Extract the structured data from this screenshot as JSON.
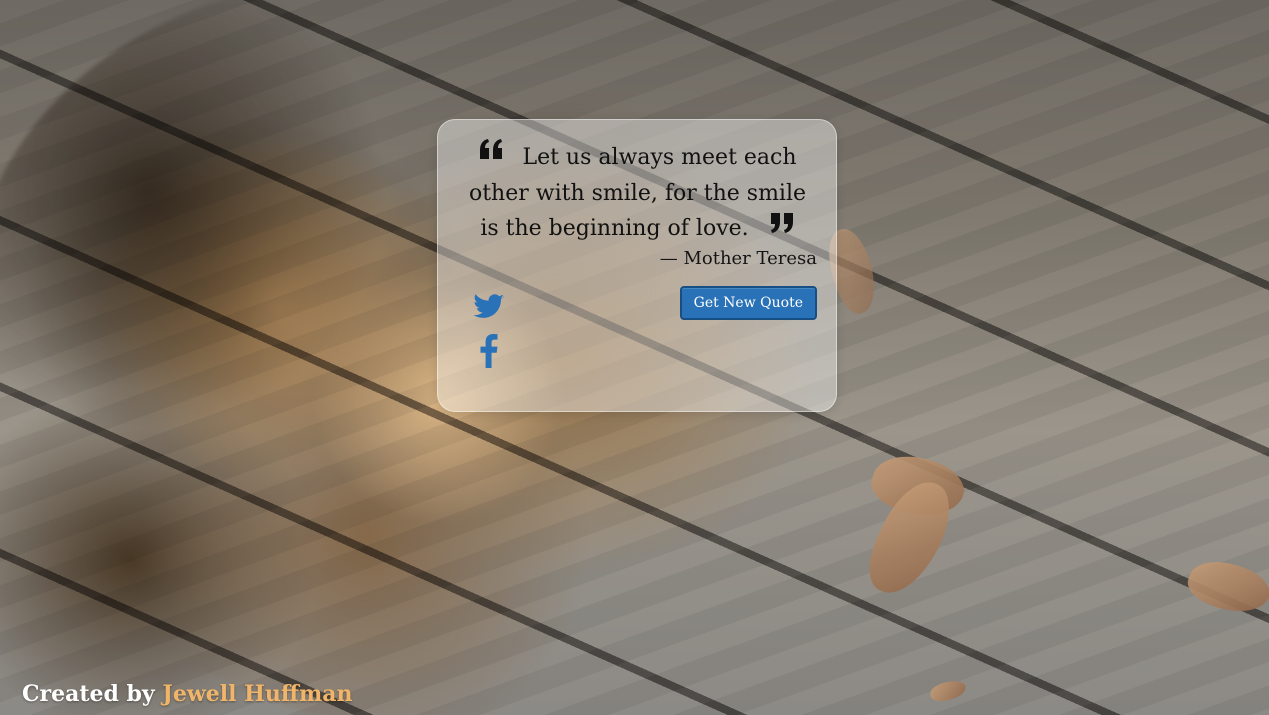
{
  "quote": {
    "text": "Let us always meet each other with smile, for the smile is the beginning of love.",
    "author": "— Mother Teresa",
    "open_icon": "quote-left-icon",
    "close_icon": "quote-right-icon"
  },
  "actions": {
    "new_quote_label": "Get New Quote"
  },
  "social": {
    "twitter_icon": "twitter-icon",
    "facebook_icon": "facebook-icon"
  },
  "footer": {
    "created_by": "Created by",
    "author_name": "Jewell Huffman"
  },
  "colors": {
    "button": "#2a72b7",
    "icon": "#2a72b7",
    "accent": "#f1b56a"
  }
}
